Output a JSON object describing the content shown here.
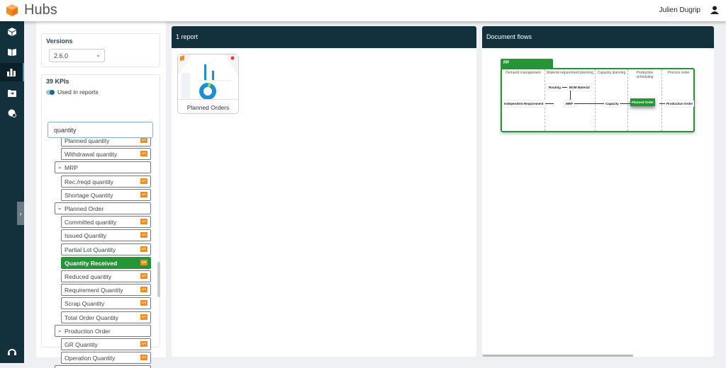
{
  "app": {
    "title": "Hubs",
    "user": "Julien Dugrip"
  },
  "sidebar": {
    "items": [
      {
        "icon": "cube-icon"
      },
      {
        "icon": "book-icon"
      },
      {
        "icon": "chart-icon",
        "active": true
      },
      {
        "icon": "folder-icon"
      },
      {
        "icon": "globe-icon"
      }
    ],
    "bottom_icon": "support-icon",
    "expand_glyph": "›"
  },
  "versions": {
    "label": "Versions",
    "selected": "2.6.0"
  },
  "kpis": {
    "count_label": "39 KPIs",
    "toggle_label": "Used in reports",
    "toggle_on": true,
    "search_value": "quantity",
    "badge": "KPI",
    "items": [
      {
        "label": "Planned quantity",
        "type": "child"
      },
      {
        "label": "Withdrawal quantity",
        "type": "child"
      },
      {
        "label": "MRP",
        "type": "group"
      },
      {
        "label": "Rec./reqd quantity",
        "type": "child"
      },
      {
        "label": "Shortage Quantity",
        "type": "child"
      },
      {
        "label": "Planned Order",
        "type": "group"
      },
      {
        "label": "Committed quantity",
        "type": "child"
      },
      {
        "label": "Issued Quantity",
        "type": "child"
      },
      {
        "label": "Partial Lot Quantity",
        "type": "child"
      },
      {
        "label": "Quantity Received",
        "type": "child",
        "selected": true
      },
      {
        "label": "Reduced quantity",
        "type": "child"
      },
      {
        "label": "Requirement Quantity",
        "type": "child"
      },
      {
        "label": "Scrap Quantity",
        "type": "child"
      },
      {
        "label": "Total Order Quantity",
        "type": "child"
      },
      {
        "label": "Production Order",
        "type": "group"
      },
      {
        "label": "GR Quantity",
        "type": "child"
      },
      {
        "label": "Operation Quantity",
        "type": "child"
      },
      {
        "label": "",
        "type": "group"
      }
    ]
  },
  "reports": {
    "header": "1 report",
    "items": [
      {
        "label": "Planned Orders"
      }
    ]
  },
  "flows": {
    "header": "Document flows",
    "module": "PP",
    "columns": [
      "Demand management",
      "Material requirement planning",
      "Capacity planning",
      "Production scheduling",
      "Procces order"
    ],
    "nodes": {
      "independent": "Independent Requirement",
      "routing": "Routing",
      "bom": "BOM Material",
      "mrp": "MRP",
      "capacity": "Capacity",
      "planned": "Planned Order",
      "production": "Production Order"
    }
  },
  "colors": {
    "sidebar": "#12313d",
    "accent": "#259536",
    "kpi_badge": "#f28c1e"
  }
}
